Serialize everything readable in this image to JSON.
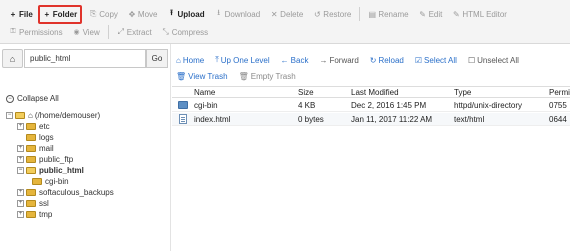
{
  "toolbar": {
    "row1": [
      {
        "icon": "+",
        "label": "File",
        "state": "active"
      },
      {
        "icon": "+",
        "label": "Folder",
        "state": "highlight"
      },
      {
        "icon": "⎘",
        "label": "Copy",
        "state": "disabled"
      },
      {
        "icon": "✥",
        "label": "Move",
        "state": "disabled"
      },
      {
        "icon": "⭱",
        "label": "Upload",
        "state": "active"
      },
      {
        "icon": "⭳",
        "label": "Download",
        "state": "disabled"
      },
      {
        "icon": "✕",
        "label": "Delete",
        "state": "disabled"
      },
      {
        "icon": "↺",
        "label": "Restore",
        "state": "disabled"
      },
      {
        "icon": "▤",
        "label": "Rename",
        "state": "disabled"
      },
      {
        "icon": "✎",
        "label": "Edit",
        "state": "disabled"
      },
      {
        "icon": "✎",
        "label": "HTML Editor",
        "state": "disabled"
      }
    ],
    "row2": [
      {
        "icon": "🔍",
        "label": "Permissions",
        "state": "disabled"
      },
      {
        "icon": "👁",
        "label": "View",
        "state": "disabled"
      },
      {
        "icon": "⤢",
        "label": "Extract",
        "state": "disabled"
      },
      {
        "icon": "⤡",
        "label": "Compress",
        "state": "disabled"
      }
    ]
  },
  "pathbar": {
    "home_icon": "home-icon",
    "path_value": "public_html",
    "go_label": "Go"
  },
  "tree": {
    "collapse_all": "Collapse All",
    "root_label": "(/home/demouser)",
    "items": [
      {
        "label": "etc",
        "depth": 1,
        "expander": "+",
        "bold": false
      },
      {
        "label": "logs",
        "depth": 1,
        "expander": "",
        "bold": false
      },
      {
        "label": "mail",
        "depth": 1,
        "expander": "+",
        "bold": false
      },
      {
        "label": "public_ftp",
        "depth": 1,
        "expander": "+",
        "bold": false
      },
      {
        "label": "public_html",
        "depth": 1,
        "expander": "−",
        "bold": true,
        "open": true
      },
      {
        "label": "cgi-bin",
        "depth": 2,
        "expander": "",
        "bold": false
      },
      {
        "label": "softaculous_backups",
        "depth": 1,
        "expander": "+",
        "bold": false
      },
      {
        "label": "ssl",
        "depth": 1,
        "expander": "+",
        "bold": false
      },
      {
        "label": "tmp",
        "depth": 1,
        "expander": "+",
        "bold": false
      }
    ]
  },
  "nav": {
    "home": "Home",
    "up": "Up One Level",
    "back": "Back",
    "forward": "Forward",
    "reload": "Reload",
    "select_all": "Select All",
    "unselect_all": "Unselect All",
    "view_trash": "View Trash",
    "empty_trash": "Empty Trash"
  },
  "table": {
    "headers": {
      "name": "Name",
      "size": "Size",
      "modified": "Last Modified",
      "type": "Type",
      "perms": "Permis"
    },
    "rows": [
      {
        "icon": "folder",
        "name": "cgi-bin",
        "size": "4 KB",
        "modified": "Dec 2, 2016 1:45 PM",
        "type": "httpd/unix-directory",
        "perms": "0755"
      },
      {
        "icon": "file",
        "name": "index.html",
        "size": "0 bytes",
        "modified": "Jan 11, 2017 11:22 AM",
        "type": "text/html",
        "perms": "0644"
      }
    ]
  },
  "colors": {
    "accent": "#2a6fc9",
    "highlight": "#e0332b",
    "folder": "#e5b53c"
  }
}
